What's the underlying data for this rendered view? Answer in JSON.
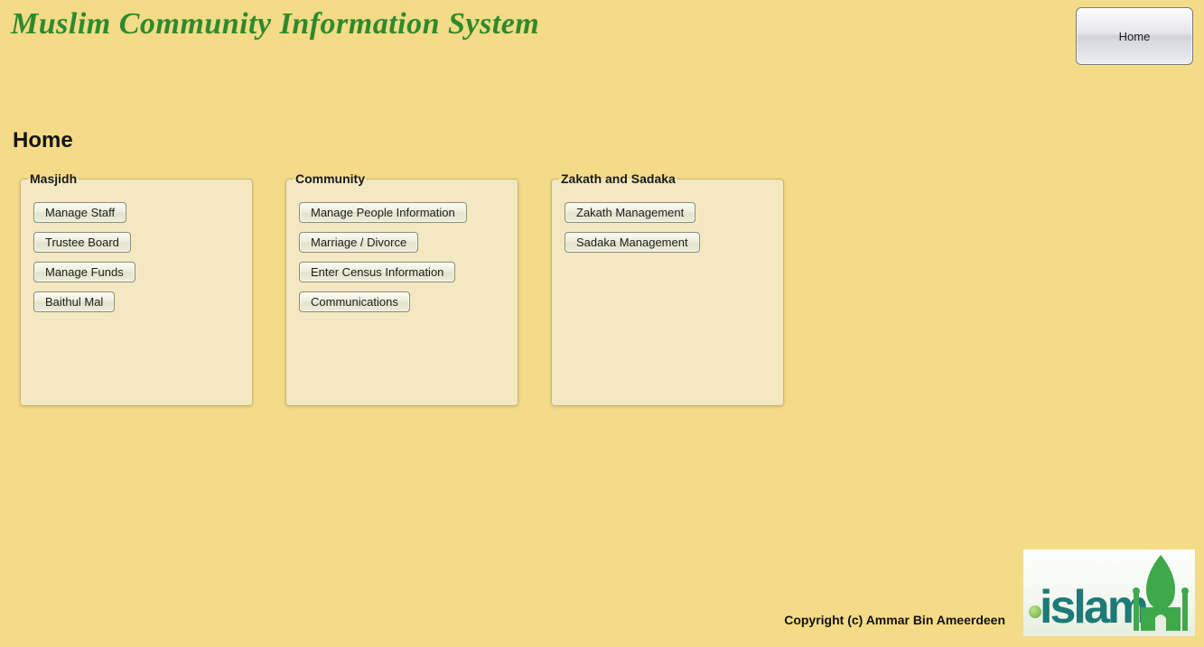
{
  "header": {
    "title": "Muslim Community Information System",
    "home_button": "Home"
  },
  "page": {
    "heading": "Home"
  },
  "panels": [
    {
      "legend": "Masjidh",
      "buttons": [
        "Manage Staff",
        "Trustee Board",
        "Manage Funds",
        "Baithul Mal"
      ]
    },
    {
      "legend": "Community",
      "buttons": [
        "Manage People Information",
        "Marriage / Divorce",
        "Enter Census Information",
        "Communications"
      ]
    },
    {
      "legend": "Zakath and Sadaka",
      "buttons": [
        "Zakath Management",
        "Sadaka Management"
      ]
    }
  ],
  "footer": {
    "copyright": "Copyright (c) Ammar Bin Ameerdeen",
    "logo_word": "islam"
  }
}
